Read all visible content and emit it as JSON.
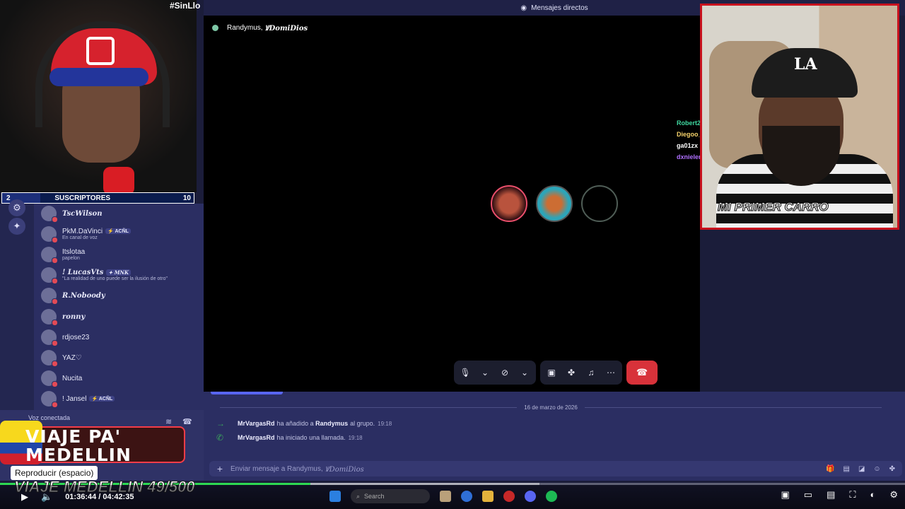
{
  "stream": {
    "hashtag": "#SinLlo",
    "sub_bar": {
      "current": "2",
      "label": "SUSCRIPTORES",
      "goal": "10",
      "fraction": 0.2
    },
    "promo_title": "VIAJE PA' MEDELLIN",
    "promo_progress": "VIAJE MEDELLIN 49/500",
    "right_cam_caption": "MI PRIMER CARRO",
    "cap_logo": "LA"
  },
  "discord": {
    "header_title": "Mensajes directos",
    "call_title_name": "Randymus,",
    "call_title_name2": "ꝞDomiDios",
    "members": [
      {
        "name": "TscWilson",
        "status": "",
        "italic": true
      },
      {
        "name": "PkM.DaVinci",
        "tag": "⚡ ACÑL",
        "status": "En canal de voz"
      },
      {
        "name": "Itslotaa",
        "status": "papelon"
      },
      {
        "name": "! LucasVts",
        "tag": "✦ MNK",
        "status": "\"La realidad de uno puede ser la ilusión de otro\"",
        "italic": true
      },
      {
        "name": "R.Noboody",
        "status": "",
        "italic": true
      },
      {
        "name": "ronny",
        "status": "",
        "italic": true
      },
      {
        "name": "rdjose23",
        "status": ""
      },
      {
        "name": "YAZ♡",
        "status": ""
      },
      {
        "name": "Nucita",
        "status": ""
      },
      {
        "name": "! Jansel",
        "tag": "⚡ ACÑL",
        "status": ""
      }
    ],
    "voice_label": "Voz conectada",
    "chat_overlay_names": [
      {
        "name": "Robert2",
        "color": "#3fd8a0"
      },
      {
        "name": "Diegoo_",
        "color": "#f6d26a"
      },
      {
        "name": "ga01zx",
        "color": "#ffffff"
      },
      {
        "name": "dxnieler",
        "color": "#b070ff"
      }
    ],
    "date_divider": "16 de marzo de 2026",
    "messages": [
      {
        "author": "MrVargasRd",
        "text1": "ha añadido a",
        "target": "Randymus",
        "text2": "al grupo.",
        "time": "19:18"
      },
      {
        "author": "MrVargasRd",
        "text1": "ha iniciado una llamada.",
        "target": "",
        "text2": "",
        "time": "19:18"
      }
    ],
    "composer_placeholder": "Enviar mensaje a Randymus,",
    "composer_placeholder2": "ꝞDomiDios"
  },
  "player": {
    "tooltip": "Reproducir (espacio)",
    "time_current": "01:36:44",
    "time_separator": "/",
    "time_total": "04:42:35",
    "played_fraction": 0.343,
    "search_placeholder": "Search"
  },
  "colors": {
    "accent_green": "#2ed852",
    "discord_blurple": "#5865f2",
    "hangup_red": "#d8323a"
  }
}
